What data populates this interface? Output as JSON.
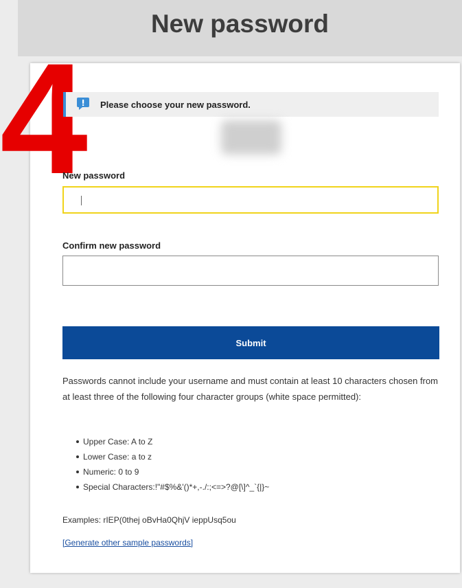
{
  "header": {
    "title": "New password"
  },
  "overlay": {
    "step_number": "4"
  },
  "notice": {
    "text": "Please choose your new password."
  },
  "form": {
    "new_password_label": "New password",
    "new_password_value": "",
    "confirm_password_label": "Confirm new password",
    "confirm_password_value": "",
    "submit_label": "Submit"
  },
  "rules": {
    "intro": "Passwords cannot include your username and must contain at least 10 characters chosen from at least three of the following four character groups (white space permitted):",
    "groups": [
      "Upper Case: A to Z",
      "Lower Case: a to z",
      "Numeric: 0 to 9",
      "Special Characters:!\"#$%&'()*+,-./:;<=>?@[\\]^_`{|}~"
    ],
    "examples": "Examples: rIEP(0thej oBvHa0QhjV ieppUsq5ou",
    "generate_link": "[Generate other sample passwords]"
  },
  "colors": {
    "accent": "#0b4a98",
    "notice_bar": "#3b8ed6",
    "focus_border": "#f0d31a",
    "step_number": "#e60000"
  },
  "icons": {
    "notice": "info-flag-icon",
    "cursor": "text-caret"
  }
}
